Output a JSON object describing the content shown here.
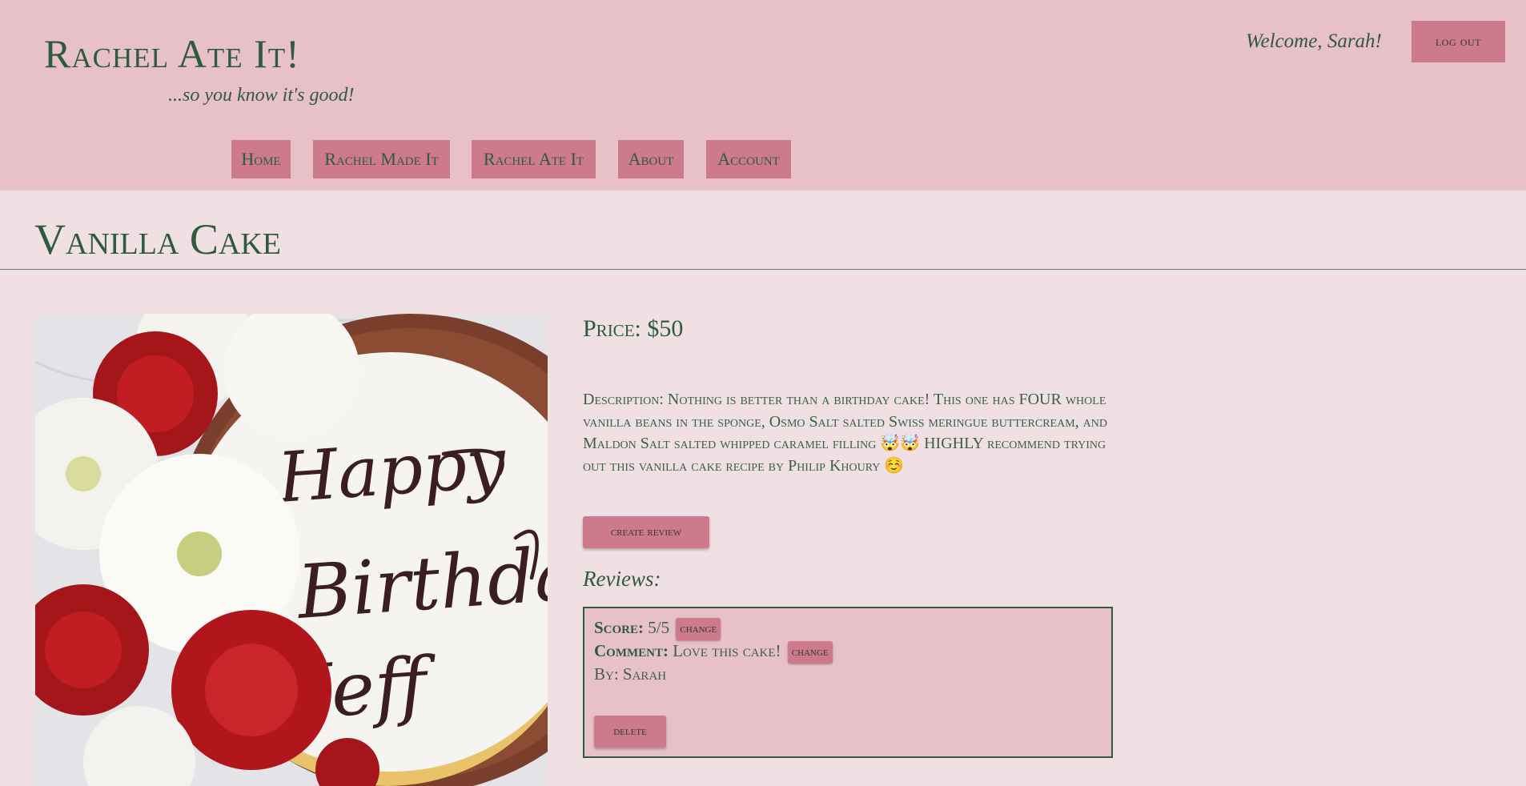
{
  "header": {
    "site_title": "Rachel Ate It!",
    "tagline": "...so you know it's good!",
    "welcome": "Welcome, Sarah!",
    "logout_label": "log out"
  },
  "nav": {
    "items": [
      {
        "label": "Home"
      },
      {
        "label": "Rachel Made It"
      },
      {
        "label": "Rachel Ate It"
      },
      {
        "label": "About"
      },
      {
        "label": "Account"
      }
    ]
  },
  "product": {
    "title": "Vanilla Cake",
    "price": "Price: $50",
    "description": "Description: Nothing is better than a birthday cake! This one has FOUR whole vanilla beans in the sponge, Osmo Salt salted Swiss meringue buttercream, and Maldon Salt salted whipped caramel filling 🤯🤯 HIGHLY recommend trying out this vanilla cake recipe by Philip Khoury ☺️",
    "image_cake_text": [
      "Happy",
      "Birthday",
      "Jeff"
    ],
    "create_review_label": "create review"
  },
  "reviews": {
    "heading": "Reviews:",
    "items": [
      {
        "score_label": "Score:",
        "score": "5/5",
        "comment_label": "Comment:",
        "comment": "Love this cake!",
        "by": "By: Sarah",
        "change_label": "change",
        "delete_label": "delete"
      }
    ]
  },
  "colors": {
    "header_bg": "#e8c0c8",
    "page_bg": "#f0dfe3",
    "button_bg": "#cc7a8c",
    "text_green": "#2e5a3f"
  }
}
